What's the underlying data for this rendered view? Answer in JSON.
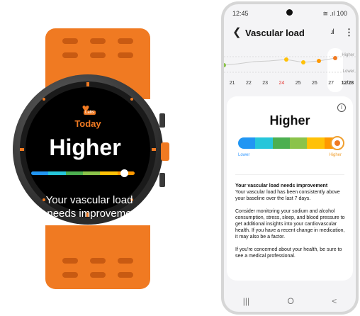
{
  "watch": {
    "brand_tag": "Labs",
    "period": "Today",
    "level": "Higher",
    "message": "Your vascular load needs improveme",
    "scale_colors": [
      "#2196f3",
      "#26c6da",
      "#4caf50",
      "#8bc34a",
      "#ffc107",
      "#ff9800"
    ],
    "level_fraction": 0.9
  },
  "phone": {
    "status": {
      "time": "12:45",
      "icons": "≅ .ıl 100"
    },
    "header": {
      "title": "Vascular load",
      "back_icon": "chevron-left-icon",
      "chart_icon": "bar-chart-icon",
      "menu_icon": "more-vertical-icon"
    },
    "chart": {
      "labels_right": [
        "Higher",
        "Lower"
      ],
      "days": [
        "21",
        "22",
        "23",
        "24",
        "25",
        "26",
        "27",
        "12/28"
      ],
      "highlight_day": "24",
      "selected_day": "12/28"
    },
    "card": {
      "level": "Higher",
      "info_icon": "info-icon",
      "scale_min_label": "Lower",
      "scale_max_label": "Higher",
      "heading": "Your vascular load needs improvement",
      "paragraphs": [
        "Your vascular load has been consistently above your baseline over the last 7 days.",
        "Consider monitoring your sodium and alcohol consumption, stress, sleep, and blood pressure to get additional insights into your cardiovascular health. If you have a recent change in medication, it may also be a factor.",
        "If you're concerned about your health, be sure to see a medical professional."
      ]
    },
    "nav": {
      "recent": "|||",
      "home": "O",
      "back": "<"
    }
  },
  "colors": {
    "accent": "#f07a22",
    "higher_label": "#f0a030",
    "lower_label": "#3399ff",
    "day_highlight": "#e53935"
  }
}
